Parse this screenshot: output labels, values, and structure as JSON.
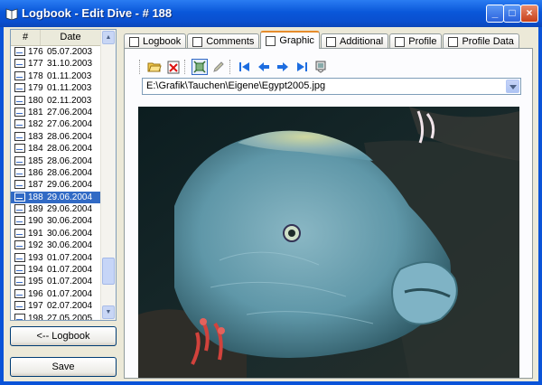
{
  "window": {
    "title": "Logbook - Edit Dive - # 188",
    "minimize_label": "_",
    "maximize_label": "□",
    "close_label": "×"
  },
  "dive_list": {
    "columns": [
      "#",
      "Date"
    ],
    "rows": [
      {
        "num": "176",
        "date": "05.07.2003"
      },
      {
        "num": "177",
        "date": "31.10.2003"
      },
      {
        "num": "178",
        "date": "01.11.2003"
      },
      {
        "num": "179",
        "date": "01.11.2003"
      },
      {
        "num": "180",
        "date": "02.11.2003"
      },
      {
        "num": "181",
        "date": "27.06.2004"
      },
      {
        "num": "182",
        "date": "27.06.2004"
      },
      {
        "num": "183",
        "date": "28.06.2004"
      },
      {
        "num": "184",
        "date": "28.06.2004"
      },
      {
        "num": "185",
        "date": "28.06.2004"
      },
      {
        "num": "186",
        "date": "28.06.2004"
      },
      {
        "num": "187",
        "date": "29.06.2004"
      },
      {
        "num": "188",
        "date": "29.06.2004",
        "selected": true
      },
      {
        "num": "189",
        "date": "29.06.2004"
      },
      {
        "num": "190",
        "date": "30.06.2004"
      },
      {
        "num": "191",
        "date": "30.06.2004"
      },
      {
        "num": "192",
        "date": "30.06.2004"
      },
      {
        "num": "193",
        "date": "01.07.2004"
      },
      {
        "num": "194",
        "date": "01.07.2004"
      },
      {
        "num": "195",
        "date": "01.07.2004"
      },
      {
        "num": "196",
        "date": "01.07.2004"
      },
      {
        "num": "197",
        "date": "02.07.2004"
      },
      {
        "num": "198",
        "date": "27.05.2005"
      }
    ]
  },
  "buttons": {
    "logbook": "<-- Logbook",
    "save": "Save"
  },
  "tabs": [
    {
      "label": "Logbook",
      "icon": "logbook-icon"
    },
    {
      "label": "Comments",
      "icon": "comments-icon"
    },
    {
      "label": "Graphic",
      "icon": "graphic-icon",
      "active": true
    },
    {
      "label": "Additional",
      "icon": "additional-icon"
    },
    {
      "label": "Profile",
      "icon": "profile-icon"
    },
    {
      "label": "Profile Data",
      "icon": "profile-data-icon"
    }
  ],
  "graphic": {
    "path": "E:\\Grafik\\Tauchen\\Eigene\\Egypt2005.jpg",
    "toolbar_icons": [
      "open-folder-icon",
      "delete-image-icon",
      "fit-image-icon",
      "edit-pencil-icon",
      "first-icon",
      "previous-icon",
      "next-icon",
      "last-icon",
      "filmstrip-icon"
    ]
  },
  "colors": {
    "selection": "#316ac5",
    "titlebar": "#0a57d9",
    "active_tab_accent": "#e68b2c"
  }
}
